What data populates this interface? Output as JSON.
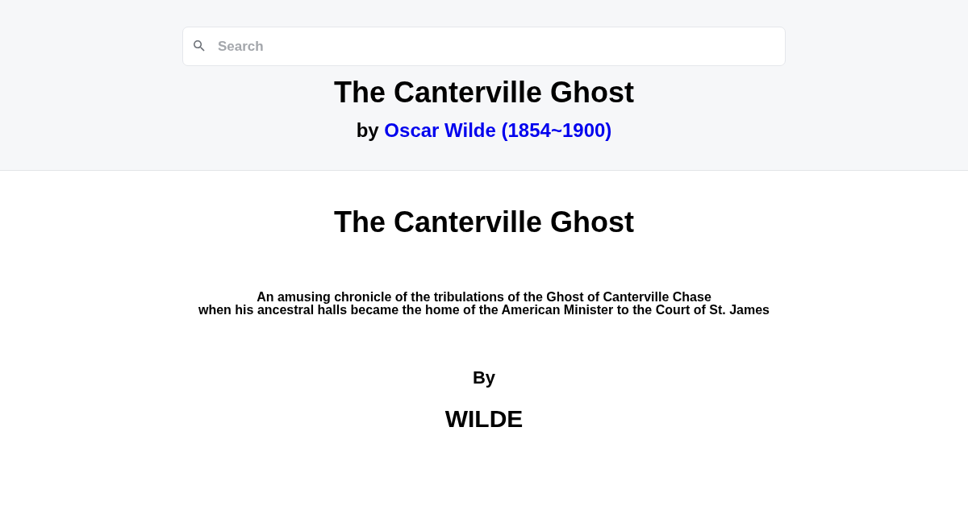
{
  "search": {
    "placeholder": "Search"
  },
  "header": {
    "title": "The Canterville Ghost",
    "byline_prefix": "by",
    "author_link": "Oscar Wilde (1854~1900)"
  },
  "content": {
    "title": "The Canterville Ghost",
    "subtitle": "An amusing chronicle of the tribulations of the Ghost of Canterville Chase\nwhen his ancestral halls became the home of the American Minister to the Court of St. James",
    "by": "By",
    "author": "WILDE"
  }
}
